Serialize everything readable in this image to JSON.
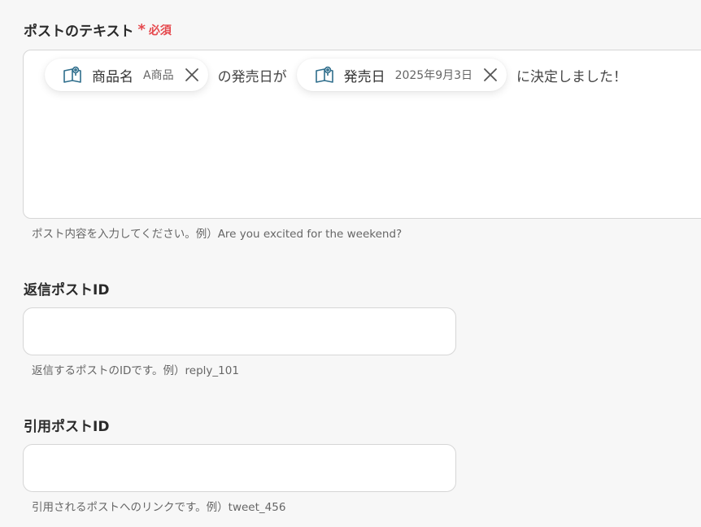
{
  "post_text": {
    "label": "ポストのテキスト",
    "required_mark": "*",
    "required_label": "必須",
    "chip1": {
      "icon": "book-icon",
      "name": "商品名",
      "value": "A商品"
    },
    "text1": "の発売日が",
    "chip2": {
      "icon": "book-icon",
      "name": "発売日",
      "value": "2025年9月3日"
    },
    "text2": "に決定しました！",
    "help": "ポスト内容を入力してください。例）Are you excited for the weekend?"
  },
  "reply_post_id": {
    "label": "返信ポストID",
    "value": "",
    "help": "返信するポストのIDです。例）reply_101"
  },
  "quote_post_id": {
    "label": "引用ポストID",
    "value": "",
    "help": "引用されるポストへのリンクです。例）tweet_456"
  },
  "colors": {
    "required": "#e5484d",
    "icon": "#2f6e8c"
  }
}
